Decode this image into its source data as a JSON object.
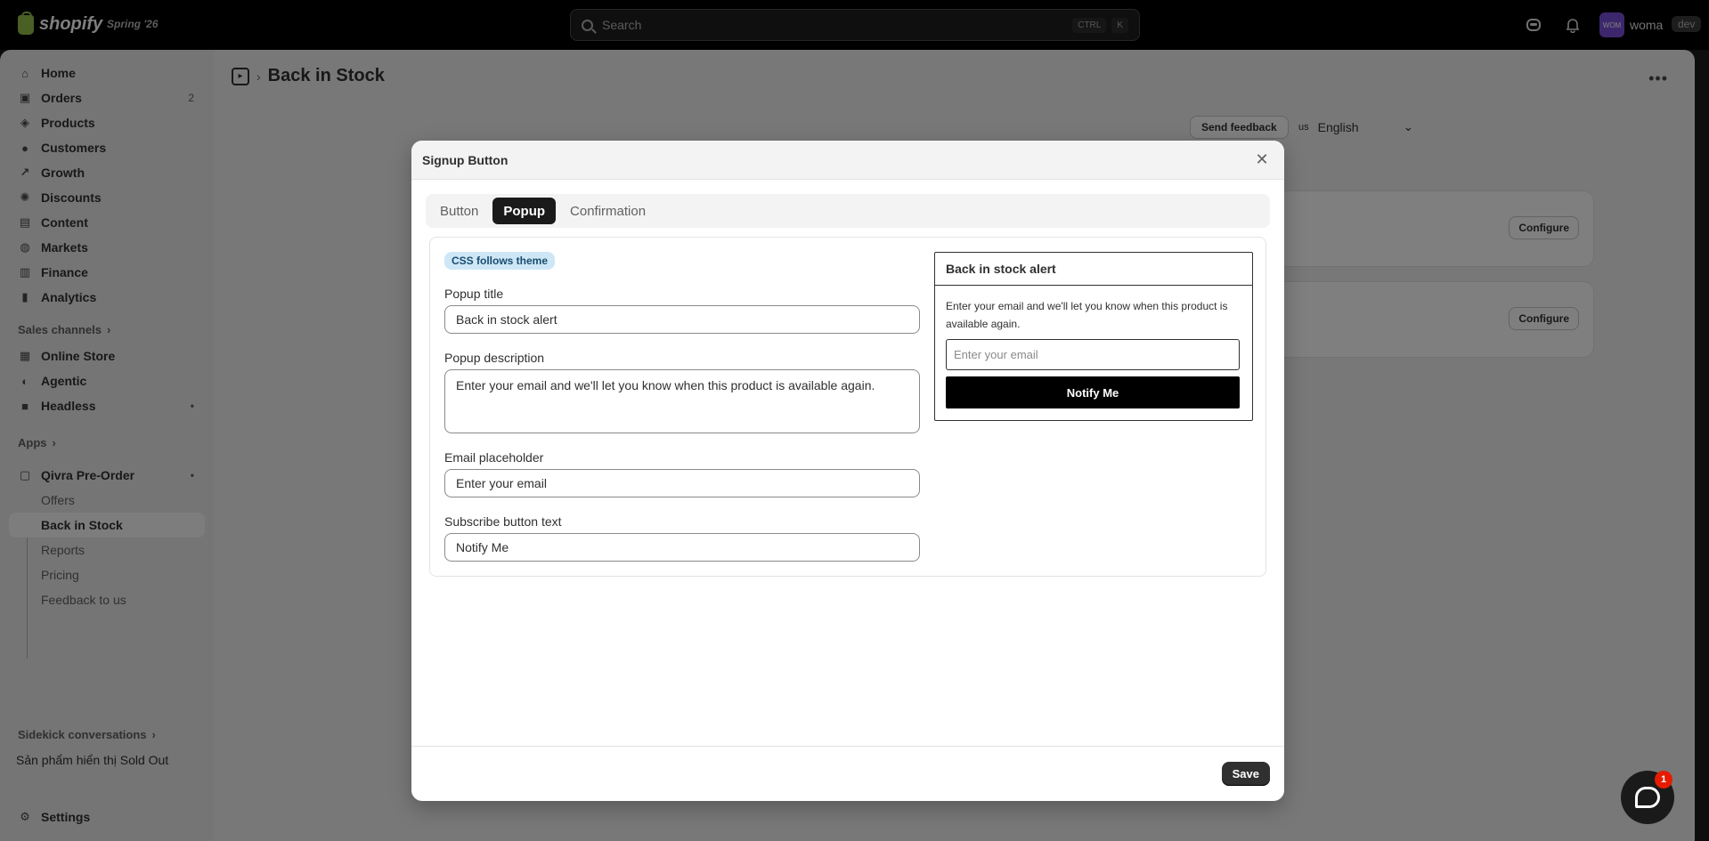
{
  "topbar": {
    "logo_text": "shopify",
    "edition": "Spring '26",
    "search_placeholder": "Search",
    "shortcut_ctrl": "CTRL",
    "shortcut_key": "K",
    "avatar_initials": "WOM",
    "user_name": "woma",
    "env_badge": "dev"
  },
  "sidebar": {
    "items": [
      {
        "label": "Home",
        "icon": "home-icon"
      },
      {
        "label": "Orders",
        "icon": "orders-icon",
        "count": "2"
      },
      {
        "label": "Products",
        "icon": "tag-icon"
      },
      {
        "label": "Customers",
        "icon": "person-icon"
      },
      {
        "label": "Growth",
        "icon": "growth-icon"
      },
      {
        "label": "Discounts",
        "icon": "discount-icon"
      },
      {
        "label": "Content",
        "icon": "content-icon"
      },
      {
        "label": "Markets",
        "icon": "globe-icon"
      },
      {
        "label": "Finance",
        "icon": "bank-icon"
      },
      {
        "label": "Analytics",
        "icon": "chart-icon"
      }
    ],
    "sales_channels_label": "Sales channels",
    "channels": [
      {
        "label": "Online Store",
        "icon": "store-icon"
      },
      {
        "label": "Agentic",
        "icon": "agentic-icon"
      },
      {
        "label": "Headless",
        "icon": "headless-icon"
      }
    ],
    "apps_label": "Apps",
    "app_name": "Qivra Pre-Order",
    "app_subitems": [
      "Offers",
      "Back in Stock",
      "Reports",
      "Pricing",
      "Feedback to us"
    ],
    "sidekick_label": "Sidekick conversations",
    "sidekick_item": "Sản phẩm hiển thị Sold Out",
    "settings_label": "Settings"
  },
  "main": {
    "page_title": "Back in Stock",
    "send_feedback": "Send feedback",
    "lang_flag": "us",
    "lang_label": "English",
    "configure_label": "Configure"
  },
  "modal": {
    "title": "Signup Button",
    "tabs": [
      "Button",
      "Popup",
      "Confirmation"
    ],
    "active_tab": "Popup",
    "css_pill": "CSS follows theme",
    "popup_title_label": "Popup title",
    "popup_title_value": "Back in stock alert",
    "popup_desc_label": "Popup description",
    "popup_desc_value": "Enter your email and we'll let you know when this product is available again.",
    "email_placeholder_label": "Email placeholder",
    "email_placeholder_value": "Enter your email",
    "subscribe_label": "Subscribe button text",
    "subscribe_value": "Notify Me",
    "preview": {
      "title": "Back in stock alert",
      "description": "Enter your email and we'll let you know when this product is available again.",
      "email_placeholder": "Enter your email",
      "button": "Notify Me"
    },
    "save_label": "Save"
  },
  "chat": {
    "badge": "1"
  },
  "colors": {
    "accent": "#303030",
    "pill_bg": "#cde7f7",
    "badge": "#e51c00",
    "avatar": "#7b4fd8"
  }
}
